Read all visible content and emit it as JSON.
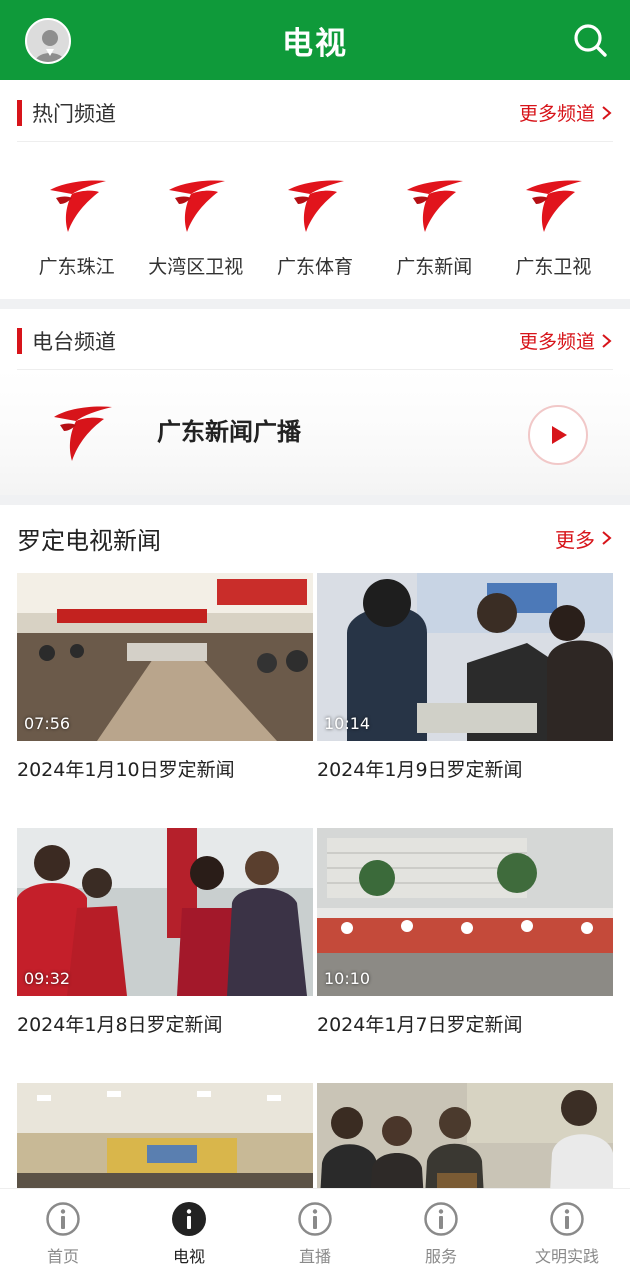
{
  "header": {
    "title": "电视"
  },
  "hot_channels": {
    "title": "热门频道",
    "more": "更多频道",
    "items": [
      {
        "label": "广东珠江"
      },
      {
        "label": "大湾区卫视"
      },
      {
        "label": "广东体育"
      },
      {
        "label": "广东新闻"
      },
      {
        "label": "广东卫视"
      }
    ]
  },
  "radio_channels": {
    "title": "电台频道",
    "more": "更多频道",
    "featured": {
      "name": "广东新闻广播"
    }
  },
  "news": {
    "title": "罗定电视新闻",
    "more": "更多",
    "items": [
      {
        "title": "2024年1月10日罗定新闻",
        "duration": "07:56"
      },
      {
        "title": "2024年1月9日罗定新闻",
        "duration": "10:14"
      },
      {
        "title": "2024年1月8日罗定新闻",
        "duration": "09:32"
      },
      {
        "title": "2024年1月7日罗定新闻",
        "duration": "10:10"
      },
      {
        "title": "",
        "duration": ""
      },
      {
        "title": "",
        "duration": ""
      }
    ]
  },
  "tabbar": {
    "items": [
      {
        "label": "首页",
        "active": false
      },
      {
        "label": "电视",
        "active": true
      },
      {
        "label": "直播",
        "active": false
      },
      {
        "label": "服务",
        "active": false
      },
      {
        "label": "文明实践",
        "active": false
      }
    ]
  },
  "colors": {
    "brand_green": "#0f9a3a",
    "accent_red": "#d7141a"
  }
}
